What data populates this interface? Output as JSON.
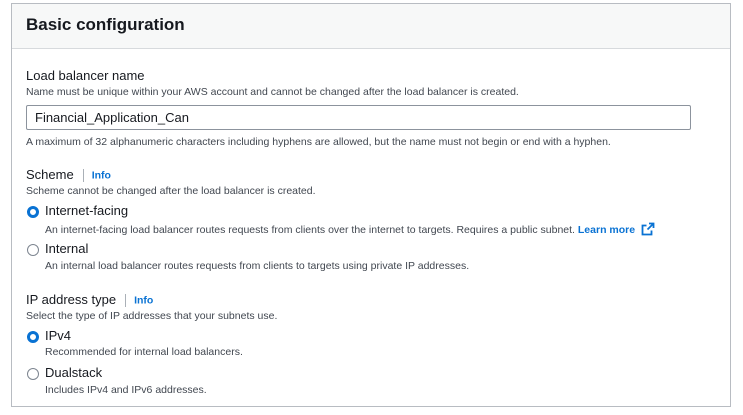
{
  "section": {
    "title": "Basic configuration"
  },
  "load_balancer_name": {
    "label": "Load balancer name",
    "description": "Name must be unique within your AWS account and cannot be changed after the load balancer is created.",
    "value": "Financial_Application_Can",
    "constraint": "A maximum of 32 alphanumeric characters including hyphens are allowed, but the name must not begin or end with a hyphen."
  },
  "scheme": {
    "label": "Scheme",
    "info": "Info",
    "description": "Scheme cannot be changed after the load balancer is created.",
    "options": [
      {
        "label": "Internet-facing",
        "selected": true,
        "description": "An internet-facing load balancer routes requests from clients over the internet to targets. Requires a public subnet.",
        "link": "Learn more"
      },
      {
        "label": "Internal",
        "selected": false,
        "description": "An internal load balancer routes requests from clients to targets using private IP addresses."
      }
    ]
  },
  "ip_address_type": {
    "label": "IP address type",
    "info": "Info",
    "description": "Select the type of IP addresses that your subnets use.",
    "options": [
      {
        "label": "IPv4",
        "selected": true,
        "description": "Recommended for internal load balancers."
      },
      {
        "label": "Dualstack",
        "selected": false,
        "description": "Includes IPv4 and IPv6 addresses."
      }
    ]
  },
  "colors": {
    "accent": "#0972d3",
    "text": "#16191f",
    "muted": "#414750",
    "border": "#8c939d"
  },
  "icons": {
    "external_link": "external-link-icon"
  }
}
